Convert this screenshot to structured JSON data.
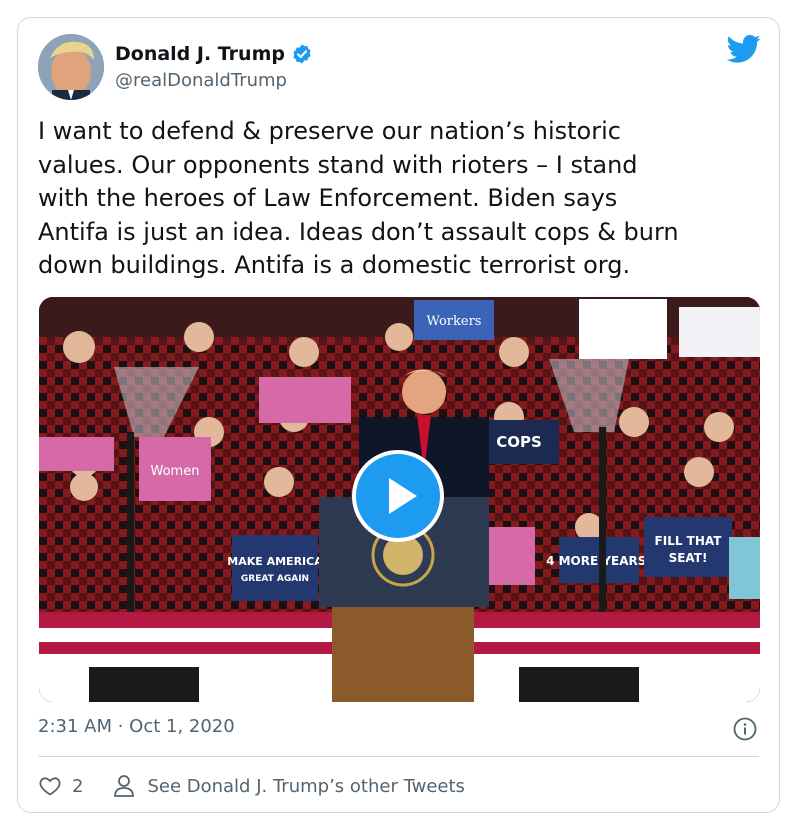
{
  "author": {
    "name": "Donald J. Trump",
    "handle": "@realDonaldTrump"
  },
  "tweet": {
    "text": "I want to defend & preserve our nation’s historic\nvalues. Our opponents stand with rioters – I stand\nwith the heroes of Law Enforcement. Biden says\nAntifa is just an idea. Ideas don’t assault cops & burn\ndown buildings. Antifa is a domestic terrorist org.",
    "timestamp": "2:31 AM · Oct 1, 2020"
  },
  "media": {
    "signs": {
      "make_america_great_again": "MAKE\nAMERICA\nGREAT AGAIN",
      "four_more_years": "4 MORE\nYEARS!",
      "fill_that_seat": "FILL THAT\nSEAT!",
      "workers": "Workers",
      "cops": "COPS",
      "women": "Women"
    }
  },
  "actions": {
    "like_count": "2",
    "profile_link": "See Donald J. Trump’s other Tweets"
  },
  "colors": {
    "accent": "#1d9bf0",
    "text": "#0f1419",
    "secondary": "#536471",
    "border": "#cfd9de"
  }
}
